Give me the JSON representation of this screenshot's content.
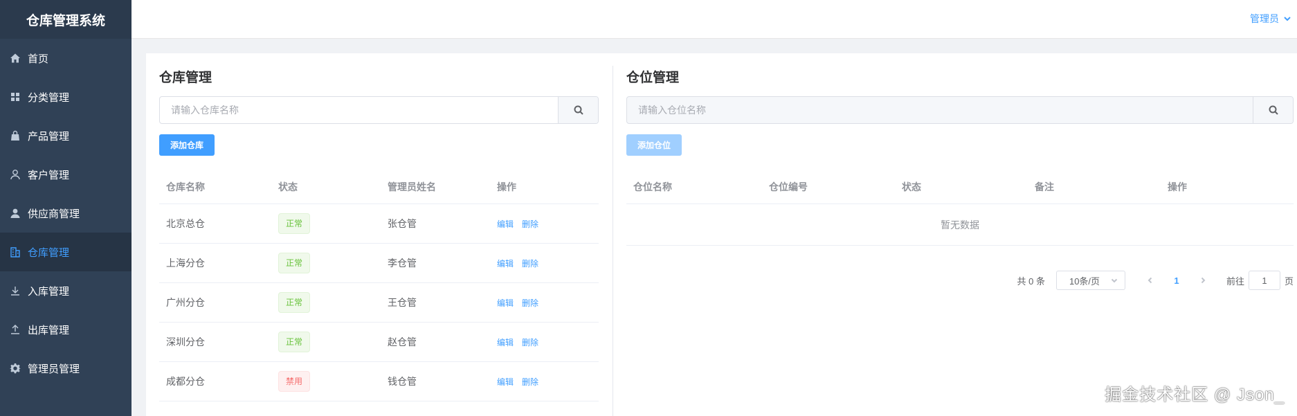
{
  "app": {
    "title": "仓库管理系统"
  },
  "sidebar": {
    "items": [
      {
        "label": "首页",
        "icon": "home-icon",
        "active": false
      },
      {
        "label": "分类管理",
        "icon": "grid-icon",
        "active": false
      },
      {
        "label": "产品管理",
        "icon": "bag-icon",
        "active": false
      },
      {
        "label": "客户管理",
        "icon": "user-outline-icon",
        "active": false
      },
      {
        "label": "供应商管理",
        "icon": "user-filled-icon",
        "active": false
      },
      {
        "label": "仓库管理",
        "icon": "building-icon",
        "active": true
      },
      {
        "label": "入库管理",
        "icon": "download-icon",
        "active": false
      },
      {
        "label": "出库管理",
        "icon": "upload-icon",
        "active": false
      },
      {
        "label": "管理员管理",
        "icon": "gear-icon",
        "active": false
      }
    ]
  },
  "header": {
    "user": "管理员"
  },
  "warehouse": {
    "title": "仓库管理",
    "search_placeholder": "请输入仓库名称",
    "add_label": "添加仓库",
    "columns": [
      "仓库名称",
      "状态",
      "管理员姓名",
      "操作"
    ],
    "rows": [
      {
        "name": "北京总仓",
        "status": "正常",
        "manager": "张仓管",
        "edit": "编辑",
        "delete": "删除"
      },
      {
        "name": "上海分仓",
        "status": "正常",
        "manager": "李仓管",
        "edit": "编辑",
        "delete": "删除"
      },
      {
        "name": "广州分仓",
        "status": "正常",
        "manager": "王仓管",
        "edit": "编辑",
        "delete": "删除"
      },
      {
        "name": "深圳分仓",
        "status": "正常",
        "manager": "赵仓管",
        "edit": "编辑",
        "delete": "删除"
      },
      {
        "name": "成都分仓",
        "status": "禁用",
        "manager": "钱仓管",
        "edit": "编辑",
        "delete": "删除"
      }
    ]
  },
  "location": {
    "title": "仓位管理",
    "search_placeholder": "请输入仓位名称",
    "add_label": "添加仓位",
    "columns": [
      "仓位名称",
      "仓位编号",
      "状态",
      "备注",
      "操作"
    ],
    "empty_text": "暂无数据",
    "pagination": {
      "total": "共 0 条",
      "page_size": "10条/页",
      "current_page": "1",
      "goto_label": "前往",
      "goto_value": "1",
      "page_suffix": "页"
    }
  },
  "watermark": "掘金技术社区 @ Json_",
  "colors": {
    "sidebar_bg": "#304156",
    "accent": "#409eff",
    "success": "#67c23a",
    "danger": "#f56c6c"
  }
}
